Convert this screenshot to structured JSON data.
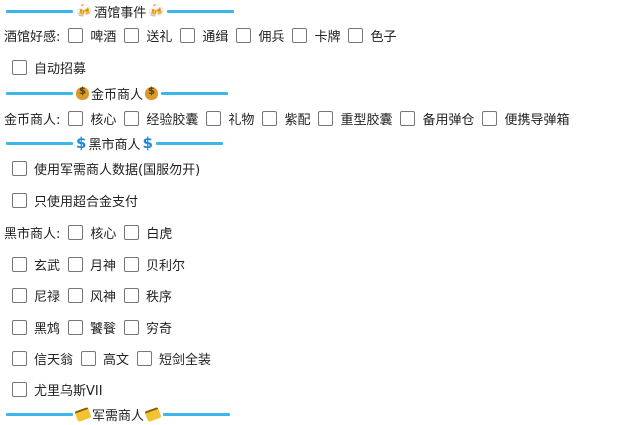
{
  "tavern": {
    "title": "酒馆事件",
    "favor_label": "酒馆好感:",
    "favor_items": [
      "啤酒",
      "送礼",
      "通缉",
      "佣兵",
      "卡牌",
      "色子"
    ],
    "auto_recruit": "自动招募"
  },
  "gold_merchant": {
    "title": "金币商人",
    "label": "金币商人:",
    "items": [
      "核心",
      "经验胶囊",
      "礼物",
      "紫配",
      "重型胶囊",
      "备用弹仓",
      "便携导弹箱"
    ]
  },
  "black_market": {
    "title": "黑市商人",
    "use_military_data": "使用军需商人数据(国服勿开)",
    "alloy_only": "只使用超合金支付",
    "label": "黑市商人:",
    "row1": [
      "核心",
      "白虎"
    ],
    "row2": [
      "玄武",
      "月神",
      "贝利尔"
    ],
    "row3": [
      "尼禄",
      "风神",
      "秩序"
    ],
    "row4": [
      "黑鸩",
      "饕餮",
      "穷奇"
    ],
    "row5": [
      "信天翁",
      "高文",
      "短剑全装"
    ],
    "row6": [
      "尤里乌斯VII"
    ]
  },
  "military_merchant": {
    "title": "军需商人"
  },
  "colors": {
    "divider": "#3bb5ea"
  }
}
